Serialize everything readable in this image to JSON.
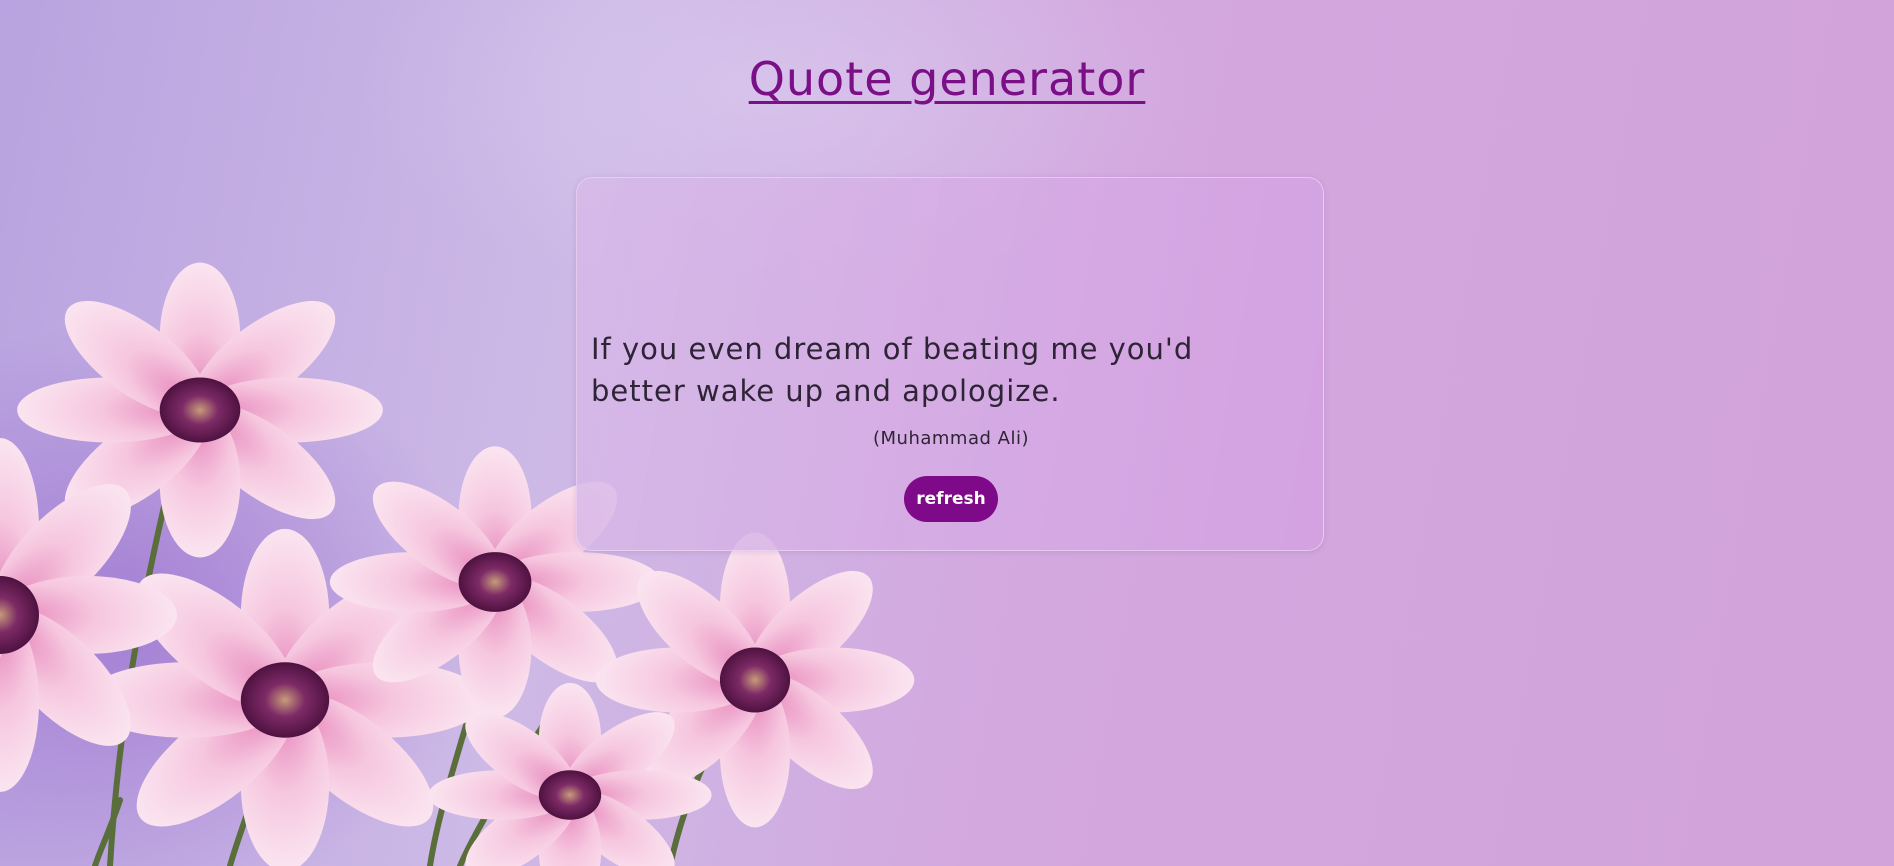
{
  "header": {
    "title": "Quote generator"
  },
  "quote_card": {
    "quote_text": "If you even dream of beating me you'd better wake up and apologize.",
    "author": "(Muhammad Ali)",
    "refresh_label": "refresh"
  },
  "colors": {
    "title": "#7a0f86",
    "button_bg": "#7f0a89",
    "quote_text": "#2e2436"
  }
}
